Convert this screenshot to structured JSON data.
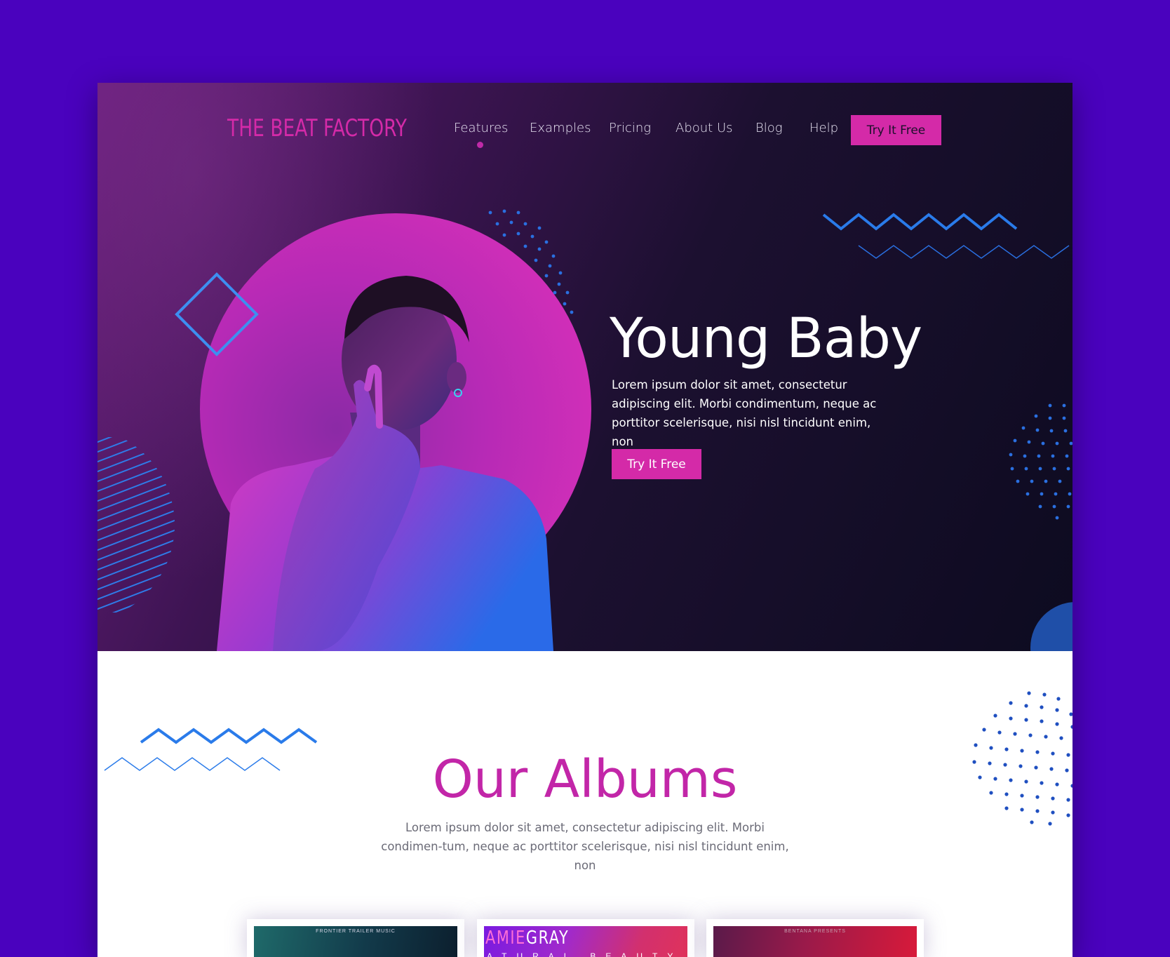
{
  "brand": {
    "logo": "THE BEAT FACTORY"
  },
  "nav": {
    "items": [
      {
        "label": "Features"
      },
      {
        "label": "Examples"
      },
      {
        "label": "Pricing"
      },
      {
        "label": "About Us"
      },
      {
        "label": "Blog"
      },
      {
        "label": "Help"
      }
    ],
    "cta": "Try It Free"
  },
  "hero": {
    "title": "Young Baby",
    "description": "Lorem ipsum dolor sit amet, consectetur adipiscing elit. Morbi condimentum, neque ac porttitor scelerisque, nisi nisl tincidunt enim, non",
    "cta": "Try It Free"
  },
  "albums": {
    "title": "Our Albums",
    "description": "Lorem ipsum dolor sit amet, consectetur adipiscing elit. Morbi condimen-tum, neque ac porttitor scelerisque, nisi nisl tincidunt enim, non",
    "cards": [
      {
        "caption": "FRONTIER TRAILER MUSIC"
      },
      {
        "artist_a": "AMIE",
        "artist_b": "GRAY",
        "subtitle": "ATURAL BEAUTY"
      },
      {
        "caption": "BENTANA PRESENTS"
      }
    ]
  },
  "colors": {
    "background": "#4a02be",
    "accent": "#d42aa8",
    "hero_dark": "#0d0b20",
    "deco_blue": "#2a7bea"
  }
}
